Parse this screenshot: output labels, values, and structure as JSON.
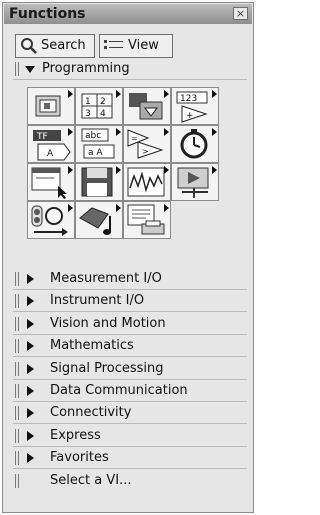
{
  "window": {
    "title": "Functions",
    "close_glyph": "×"
  },
  "toolbar": {
    "search_label": "Search",
    "view_label": "View"
  },
  "expanded_section": {
    "label": "Programming"
  },
  "sections": [
    {
      "label": "Measurement I/O"
    },
    {
      "label": "Instrument I/O"
    },
    {
      "label": "Vision and Motion"
    },
    {
      "label": "Mathematics"
    },
    {
      "label": "Signal Processing"
    },
    {
      "label": "Data Communication"
    },
    {
      "label": "Connectivity"
    },
    {
      "label": "Express"
    },
    {
      "label": "Favorites"
    }
  ],
  "select_vi": {
    "label": "Select a VI..."
  },
  "palette_icons": {
    "row1_cell2": "1 2 3 4",
    "row1_cell4": "123",
    "row2_cell1": "TF",
    "row2_cell2_top": "abc",
    "row2_cell2_bottom": "a A"
  },
  "colors": {
    "titlebar": "#9a9a9a",
    "background": "#e6e6e6",
    "cell": "#f4f4f4"
  }
}
